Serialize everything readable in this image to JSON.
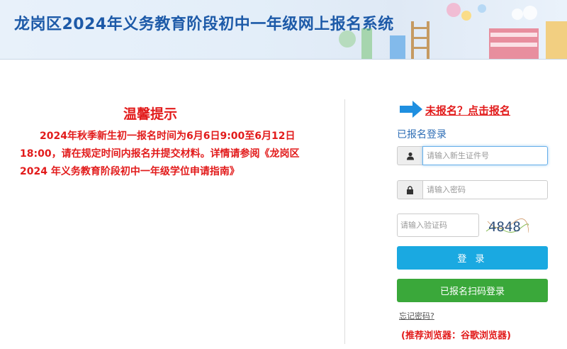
{
  "header": {
    "title": "龙岗区2024年义务教育阶段初中一年级网上报名系统"
  },
  "notice": {
    "title": "温馨提示",
    "body": "2024年秋季新生初一报名时间为6月6日9:00至6月12日18:00，请在规定时间内报名并提交材料。详情请参阅《龙岗区 2024 年义务教育阶段初中一年级学位申请指南》"
  },
  "login": {
    "register_link": "未报名？点击报名",
    "heading": "已报名登录",
    "id_placeholder": "请输入新生证件号",
    "password_placeholder": "请输入密码",
    "captcha_placeholder": "请输入验证码",
    "captcha_text": "4848",
    "login_button": "登 录",
    "scan_button": "已报名扫码登录",
    "forgot_link": "忘记密码?",
    "browser_tip_label": "(推荐浏览器：",
    "browser_tip_value": "谷歌浏览器)"
  },
  "colors": {
    "title_blue": "#1d5aa8",
    "notice_red": "#e21b1b",
    "login_blue": "#1aa9e1",
    "scan_green": "#3aa83a"
  },
  "icons": [
    "user-icon",
    "lock-icon",
    "arrow-right-icon"
  ]
}
